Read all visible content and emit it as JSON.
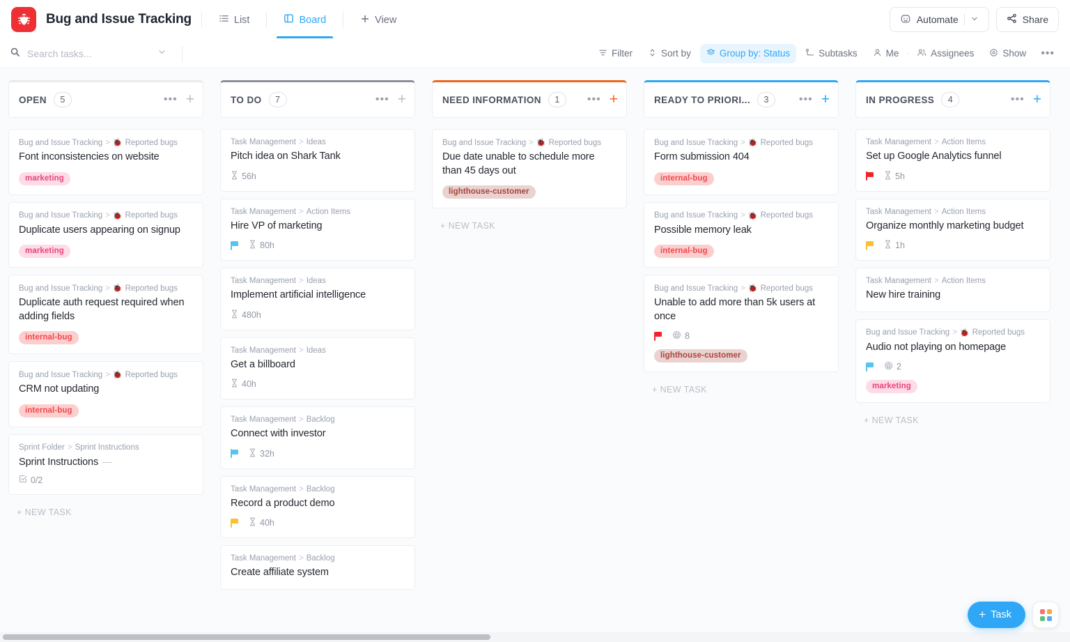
{
  "header": {
    "logo_icon": "bug-icon",
    "logo_color": "#ee2f34",
    "title": "Bug and Issue Tracking",
    "views": [
      {
        "label": "List",
        "icon": "list-icon",
        "active": false
      },
      {
        "label": "Board",
        "icon": "board-icon",
        "active": true
      },
      {
        "label": "View",
        "icon": "plus-icon",
        "active": false
      }
    ],
    "automate_label": "Automate",
    "automate_icon": "robot-icon",
    "share_label": "Share",
    "share_icon": "share-icon",
    "accent_color": "#2fa7f6"
  },
  "toolbar": {
    "search_placeholder": "Search tasks...",
    "search_value": "",
    "search_icon": "search-icon",
    "search_chevron": "chevron-down-icon",
    "items": [
      {
        "label": "Filter",
        "icon": "filter-icon",
        "active": false
      },
      {
        "label": "Sort by",
        "icon": "sort-icon",
        "active": false
      },
      {
        "label": "Group by: Status",
        "icon": "group-icon",
        "active": true
      },
      {
        "label": "Subtasks",
        "icon": "subtasks-icon",
        "active": false
      },
      {
        "label": "Me",
        "icon": "person-icon",
        "active": false
      },
      {
        "label": "Assignees",
        "icon": "people-icon",
        "active": false
      },
      {
        "label": "Show",
        "icon": "eye-icon",
        "active": false
      }
    ],
    "more_label": "•••"
  },
  "board": {
    "new_task_label": "+ NEW TASK",
    "columns": [
      {
        "name": "OPEN",
        "count": "5",
        "accent": "#e7e9ec",
        "plus_color": "#b8bcc5",
        "cards": [
          {
            "crumb_root": "Bug and Issue Tracking",
            "crumb_sep": ">",
            "crumb_leaf": "Reported bugs",
            "crumb_emoji": "🐞",
            "title": "Font inconsistencies on website",
            "tag": "marketing",
            "tag_style": "marketing"
          },
          {
            "crumb_root": "Bug and Issue Tracking",
            "crumb_sep": ">",
            "crumb_leaf": "Reported bugs",
            "crumb_emoji": "🐞",
            "title": "Duplicate users appearing on signup",
            "tag": "marketing",
            "tag_style": "marketing"
          },
          {
            "crumb_root": "Bug and Issue Tracking",
            "crumb_sep": ">",
            "crumb_leaf": "Reported bugs",
            "crumb_emoji": "🐞",
            "title": "Duplicate auth request required when adding fields",
            "tag": "internal-bug",
            "tag_style": "internalbug"
          },
          {
            "crumb_root": "Bug and Issue Tracking",
            "crumb_sep": ">",
            "crumb_leaf": "Reported bugs",
            "crumb_emoji": "🐞",
            "title": "CRM not updating",
            "tag": "internal-bug",
            "tag_style": "internalbug"
          },
          {
            "crumb_root": "Sprint Folder",
            "crumb_sep": ">",
            "crumb_leaf": "Sprint Instructions",
            "crumb_emoji": "",
            "title": "Sprint Instructions",
            "title_dash": "—",
            "checklist": "0/2",
            "checklist_icon": "checkbox-icon"
          }
        ]
      },
      {
        "name": "TO DO",
        "count": "7",
        "accent": "#8b8f98",
        "plus_color": "#b8bcc5",
        "cards": [
          {
            "crumb_root": "Task Management",
            "crumb_sep": ">",
            "crumb_leaf": "Ideas",
            "crumb_emoji": "",
            "title": "Pitch idea on Shark Tank",
            "time": "56h",
            "time_icon": "hourglass-icon"
          },
          {
            "crumb_root": "Task Management",
            "crumb_sep": ">",
            "crumb_leaf": "Action Items",
            "crumb_emoji": "",
            "title": "Hire VP of marketing",
            "flag": "#56c3f0",
            "time": "80h",
            "time_icon": "hourglass-icon"
          },
          {
            "crumb_root": "Task Management",
            "crumb_sep": ">",
            "crumb_leaf": "Ideas",
            "crumb_emoji": "",
            "title": "Implement artificial intelligence",
            "time": "480h",
            "time_icon": "hourglass-icon"
          },
          {
            "crumb_root": "Task Management",
            "crumb_sep": ">",
            "crumb_leaf": "Ideas",
            "crumb_emoji": "",
            "title": "Get a billboard",
            "time": "40h",
            "time_icon": "hourglass-icon"
          },
          {
            "crumb_root": "Task Management",
            "crumb_sep": ">",
            "crumb_leaf": "Backlog",
            "crumb_emoji": "",
            "title": "Connect with investor",
            "flag": "#56c3f0",
            "time": "32h",
            "time_icon": "hourglass-icon"
          },
          {
            "crumb_root": "Task Management",
            "crumb_sep": ">",
            "crumb_leaf": "Backlog",
            "crumb_emoji": "",
            "title": "Record a product demo",
            "flag": "#fcc02e",
            "time": "40h",
            "time_icon": "hourglass-icon"
          },
          {
            "crumb_root": "Task Management",
            "crumb_sep": ">",
            "crumb_leaf": "Backlog",
            "crumb_emoji": "",
            "title": "Create affiliate system"
          }
        ]
      },
      {
        "name": "NEED INFORMATION",
        "count": "1",
        "accent": "#f3641c",
        "plus_color": "#f3641c",
        "cards": [
          {
            "crumb_root": "Bug and Issue Tracking",
            "crumb_sep": ">",
            "crumb_leaf": "Reported bugs",
            "crumb_emoji": "🐞",
            "title": "Due date unable to schedule more than 45 days out",
            "tag": "lighthouse-customer",
            "tag_style": "lighthouse"
          }
        ]
      },
      {
        "name": "READY TO PRIORI...",
        "count": "3",
        "accent": "#2fa7f6",
        "plus_color": "#2fa7f6",
        "cards": [
          {
            "crumb_root": "Bug and Issue Tracking",
            "crumb_sep": ">",
            "crumb_leaf": "Reported bugs",
            "crumb_emoji": "🐞",
            "title": "Form submission 404",
            "tag": "internal-bug",
            "tag_style": "internalbug"
          },
          {
            "crumb_root": "Bug and Issue Tracking",
            "crumb_sep": ">",
            "crumb_leaf": "Reported bugs",
            "crumb_emoji": "🐞",
            "title": "Possible memory leak",
            "tag": "internal-bug",
            "tag_style": "internalbug"
          },
          {
            "crumb_root": "Bug and Issue Tracking",
            "crumb_sep": ">",
            "crumb_leaf": "Reported bugs",
            "crumb_emoji": "🐞",
            "title": "Unable to add more than 5k users at once",
            "flag": "#f3222a",
            "points": "8",
            "points_icon": "sprint-points-icon",
            "tag": "lighthouse-customer",
            "tag_style": "lighthouse"
          }
        ]
      },
      {
        "name": "IN PROGRESS",
        "count": "4",
        "accent": "#2fa7f6",
        "plus_color": "#2fa7f6",
        "cards": [
          {
            "crumb_root": "Task Management",
            "crumb_sep": ">",
            "crumb_leaf": "Action Items",
            "crumb_emoji": "",
            "title": "Set up Google Analytics funnel",
            "flag": "#f3222a",
            "time": "5h",
            "time_icon": "hourglass-icon"
          },
          {
            "crumb_root": "Task Management",
            "crumb_sep": ">",
            "crumb_leaf": "Action Items",
            "crumb_emoji": "",
            "title": "Organize monthly marketing budget",
            "flag": "#fcc02e",
            "time": "1h",
            "time_icon": "hourglass-icon"
          },
          {
            "crumb_root": "Task Management",
            "crumb_sep": ">",
            "crumb_leaf": "Action Items",
            "crumb_emoji": "",
            "title": "New hire training"
          },
          {
            "crumb_root": "Bug and Issue Tracking",
            "crumb_sep": ">",
            "crumb_leaf": "Reported bugs",
            "crumb_emoji": "🐞",
            "title": "Audio not playing on homepage",
            "flag": "#56c3f0",
            "points": "2",
            "points_icon": "sprint-points-icon",
            "tag": "marketing",
            "tag_style": "marketing"
          }
        ]
      }
    ]
  },
  "floating": {
    "task_label": "Task",
    "task_plus": "+",
    "apps_icon": "apps-grid-icon",
    "apps_colors": [
      "#f4726f",
      "#f7a93b",
      "#5ec07a",
      "#5aa9f5"
    ]
  }
}
